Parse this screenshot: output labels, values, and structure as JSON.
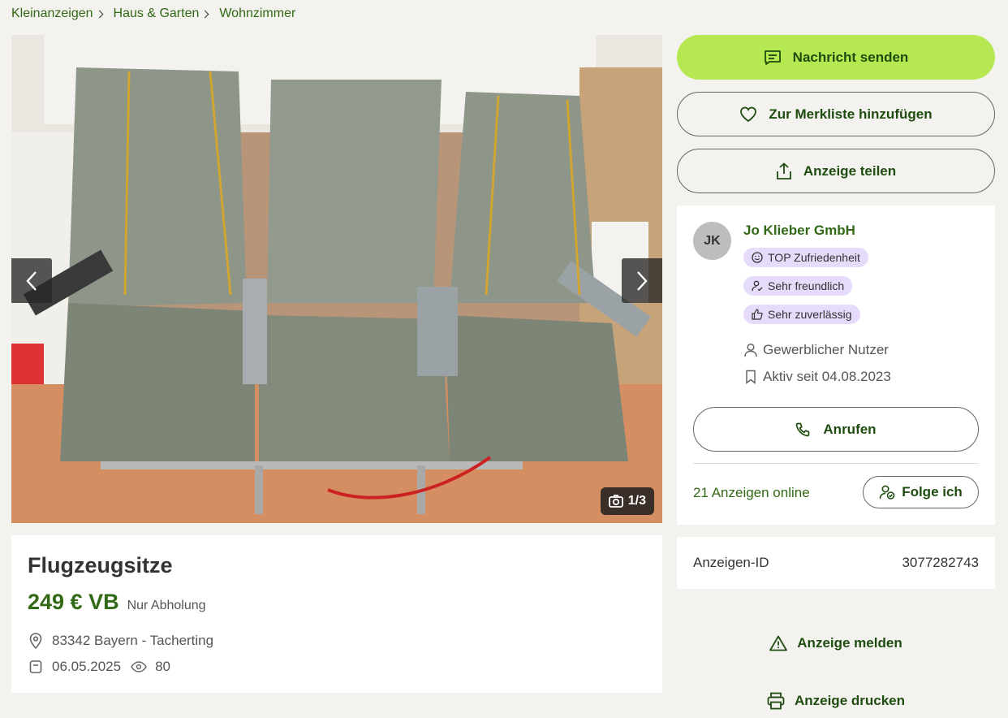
{
  "breadcrumb": [
    "Kleinanzeigen",
    "Haus & Garten",
    "Wohnzimmer"
  ],
  "gallery": {
    "counter": "1/3",
    "prev_icon": "chevron-left-icon",
    "next_icon": "chevron-right-icon",
    "counter_icon": "camera-icon"
  },
  "listing": {
    "title": "Flugzeugsitze",
    "price": "249 € VB",
    "pickup": "Nur Abholung",
    "location": "83342 Bayern - Tacherting",
    "date": "06.05.2025",
    "views": "80"
  },
  "actions": {
    "message": "Nachricht senden",
    "watchlist": "Zur Merkliste hinzufügen",
    "share": "Anzeige teilen",
    "report": "Anzeige melden",
    "print": "Anzeige drucken"
  },
  "seller": {
    "initials": "JK",
    "name": "Jo Klieber GmbH",
    "badges": [
      "TOP Zufriedenheit",
      "Sehr freundlich",
      "Sehr zuverlässig"
    ],
    "type": "Gewerblicher Nutzer",
    "active_since": "Aktiv seit 04.08.2023",
    "call": "Anrufen",
    "ads_online": "21 Anzeigen online",
    "follow": "Folge ich"
  },
  "ad_id": {
    "label": "Anzeigen-ID",
    "value": "3077282743"
  },
  "colors": {
    "brand_green": "#326916",
    "primary_button": "#b5e851",
    "badge_bg": "#e6dbfb",
    "page_bg": "#f3f2ee"
  }
}
